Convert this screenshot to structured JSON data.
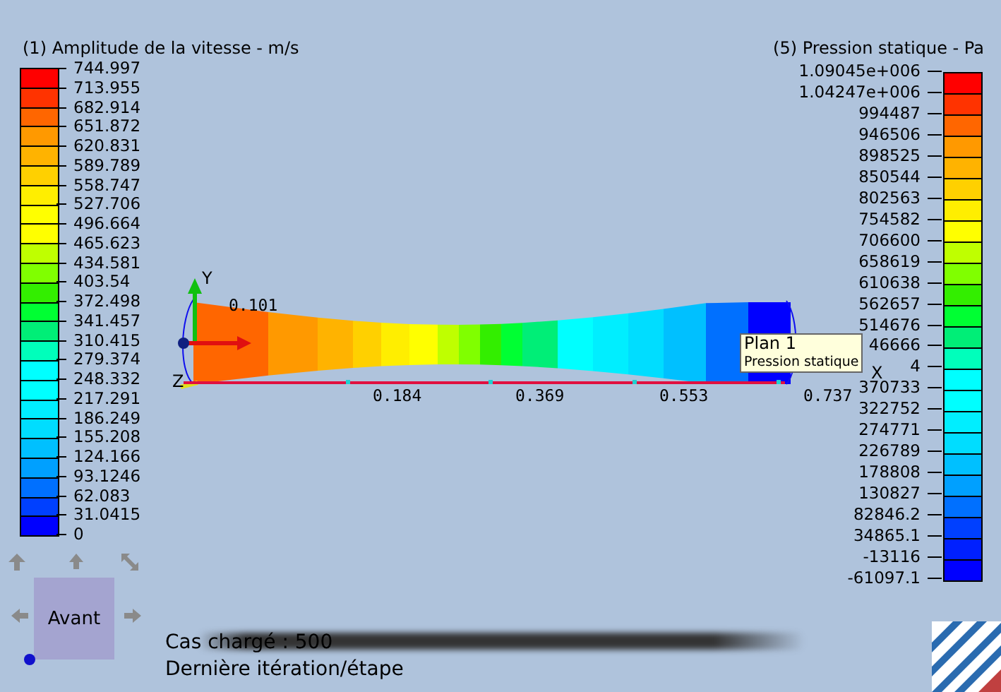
{
  "velocity_legend": {
    "title": "(1) Amplitude de la vitesse - m/s",
    "labels": [
      "744.997",
      "713.955",
      "682.914",
      "651.872",
      "620.831",
      "589.789",
      "558.747",
      "527.706",
      "496.664",
      "465.623",
      "434.581",
      "403.54",
      "372.498",
      "341.457",
      "310.415",
      "279.374",
      "248.332",
      "217.291",
      "186.249",
      "155.208",
      "124.166",
      "93.1246",
      "62.083",
      "31.0415",
      "0"
    ],
    "bands": [
      {
        "color": "#ff0000"
      },
      {
        "color": "#ff3300"
      },
      {
        "color": "#ff6600"
      },
      {
        "color": "#ff9900"
      },
      {
        "color": "#ffb300"
      },
      {
        "color": "#ffd000"
      },
      {
        "color": "#ffee00"
      },
      {
        "color": "#ffff00"
      },
      {
        "color": "#ffff00"
      },
      {
        "color": "#bfff00"
      },
      {
        "color": "#80ff00"
      },
      {
        "color": "#33ee00"
      },
      {
        "color": "#00ff33"
      },
      {
        "color": "#00ee77"
      },
      {
        "color": "#00ffbb"
      },
      {
        "color": "#00ffff"
      },
      {
        "color": "#00ffff"
      },
      {
        "color": "#00eeff"
      },
      {
        "color": "#00ddff"
      },
      {
        "color": "#00c0ff"
      },
      {
        "color": "#00a0ff"
      },
      {
        "color": "#0070ff"
      },
      {
        "color": "#0040ff"
      },
      {
        "color": "#0000ff"
      }
    ]
  },
  "pressure_legend": {
    "title": "(5) Pression statique - Pa",
    "labels": [
      "1.09045e+006",
      "1.04247e+006",
      "994487",
      "946506",
      "898525",
      "850544",
      "802563",
      "754582",
      "706600",
      "658619",
      "610638",
      "562657",
      "514676",
      "46666",
      "4",
      "370733",
      "322752",
      "274771",
      "226789",
      "178808",
      "130827",
      "82846.2",
      "34865.1",
      "-13116",
      "-61097.1"
    ],
    "bands": [
      {
        "color": "#ff0000"
      },
      {
        "color": "#ff3300"
      },
      {
        "color": "#ff6600"
      },
      {
        "color": "#ff9900"
      },
      {
        "color": "#ffb300"
      },
      {
        "color": "#ffd000"
      },
      {
        "color": "#ffee00"
      },
      {
        "color": "#ffff00"
      },
      {
        "color": "#bfff00"
      },
      {
        "color": "#80ff00"
      },
      {
        "color": "#33ee00"
      },
      {
        "color": "#00ff33"
      },
      {
        "color": "#00ee77"
      },
      {
        "color": "#00ffbb"
      },
      {
        "color": "#00ffff"
      },
      {
        "color": "#00ffff"
      },
      {
        "color": "#00eeff"
      },
      {
        "color": "#00ddff"
      },
      {
        "color": "#00c0ff"
      },
      {
        "color": "#00a0ff"
      },
      {
        "color": "#0070ff"
      },
      {
        "color": "#0040ff"
      },
      {
        "color": "#0020ff"
      },
      {
        "color": "#0000ff"
      }
    ]
  },
  "viewport": {
    "axis_labels": [
      "Y",
      "Z",
      "X"
    ],
    "top_value": "0.101",
    "ticks": [
      "0.184",
      "0.369",
      "0.553",
      "0.737"
    ]
  },
  "tooltip": {
    "title": "Plan 1",
    "subtitle": "Pression statique"
  },
  "view_cube": {
    "face": "Avant"
  },
  "status": [
    "Cas chargé : 500",
    "Dernière itération/étape"
  ]
}
